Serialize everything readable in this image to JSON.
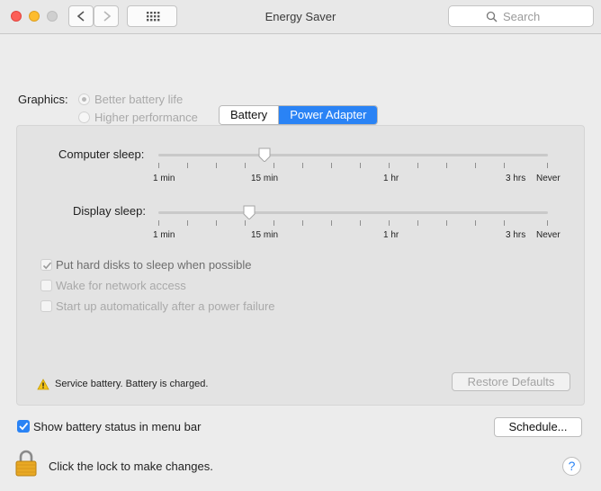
{
  "window": {
    "title": "Energy Saver",
    "search_placeholder": "Search"
  },
  "graphics": {
    "label": "Graphics:",
    "options": [
      "Better battery life",
      "Higher performance"
    ],
    "selected": "Better battery life"
  },
  "tabs": {
    "items": [
      "Battery",
      "Power Adapter"
    ],
    "selected": "Power Adapter"
  },
  "sliders": {
    "computer_sleep": {
      "label": "Computer sleep:",
      "ticks": [
        "1 min",
        "15 min",
        "1 hr",
        "3 hrs",
        "Never"
      ],
      "value": "15 min"
    },
    "display_sleep": {
      "label": "Display sleep:",
      "ticks": [
        "1 min",
        "15 min",
        "1 hr",
        "3 hrs",
        "Never"
      ],
      "value": "~10 min"
    }
  },
  "options": {
    "hard_disks": {
      "label": "Put hard disks to sleep when possible",
      "checked": true,
      "enabled": true
    },
    "wake_network": {
      "label": "Wake for network access",
      "checked": false,
      "enabled": false
    },
    "startup_power": {
      "label": "Start up automatically after a power failure",
      "checked": false,
      "enabled": false
    }
  },
  "status": {
    "text": "Service battery. Battery is charged."
  },
  "buttons": {
    "restore_defaults": "Restore Defaults",
    "schedule": "Schedule...",
    "help": "?"
  },
  "menu_bar_option": {
    "label": "Show battery status in menu bar",
    "checked": true
  },
  "lock": {
    "text": "Click the lock to make changes."
  },
  "colors": {
    "accent": "#2a83f5",
    "warning": "#f5c518"
  }
}
